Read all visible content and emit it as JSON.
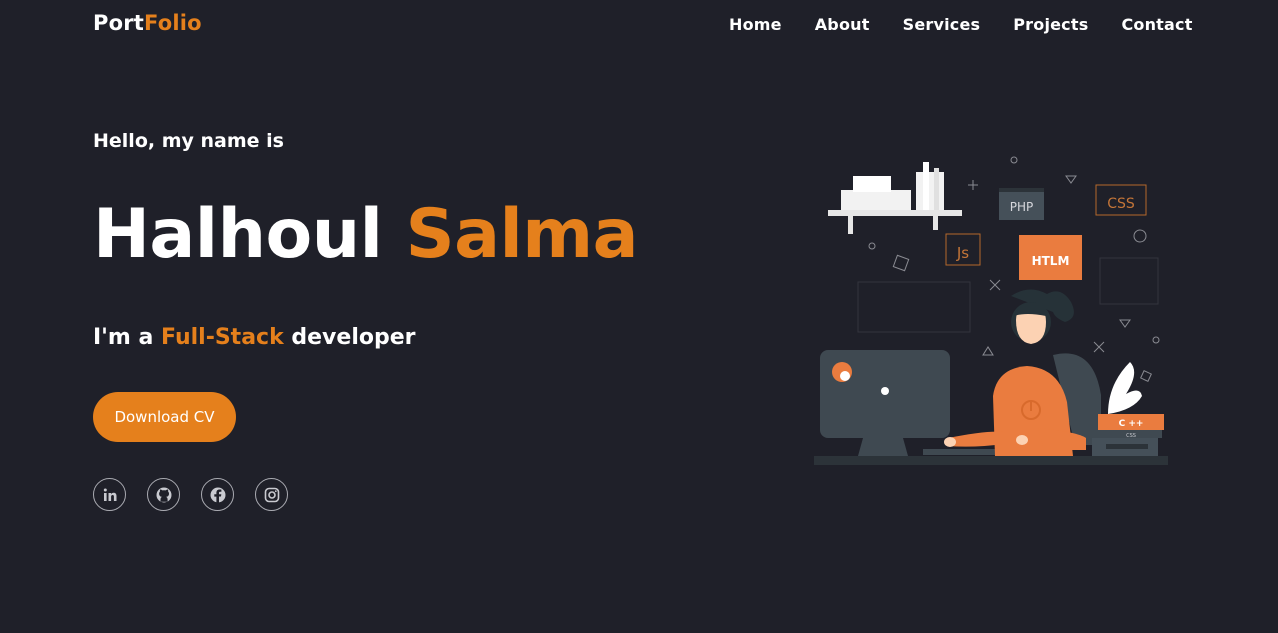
{
  "brand": {
    "part1": "Port",
    "part2": "Folio"
  },
  "nav": [
    "Home",
    "About",
    "Services",
    "Projects",
    "Contact"
  ],
  "hero": {
    "greeting": "Hello, my name is",
    "first_name": "Halhoul",
    "last_name": "Salma",
    "role_prefix": "I'm a",
    "role_highlight": "Full-Stack",
    "role_suffix": "developer",
    "cta": "Download CV"
  },
  "socials": [
    {
      "name": "linkedin",
      "glyph": "in"
    },
    {
      "name": "github",
      "glyph": "⌥"
    },
    {
      "name": "facebook",
      "glyph": "f"
    },
    {
      "name": "instagram",
      "glyph": "◎"
    }
  ],
  "illustration": {
    "badges": [
      "PHP",
      "CSS",
      "Js",
      "HTLM",
      "C ++",
      "CSS"
    ]
  },
  "colors": {
    "accent": "#e5801c",
    "background": "#1f2029",
    "text": "#ffffff"
  }
}
